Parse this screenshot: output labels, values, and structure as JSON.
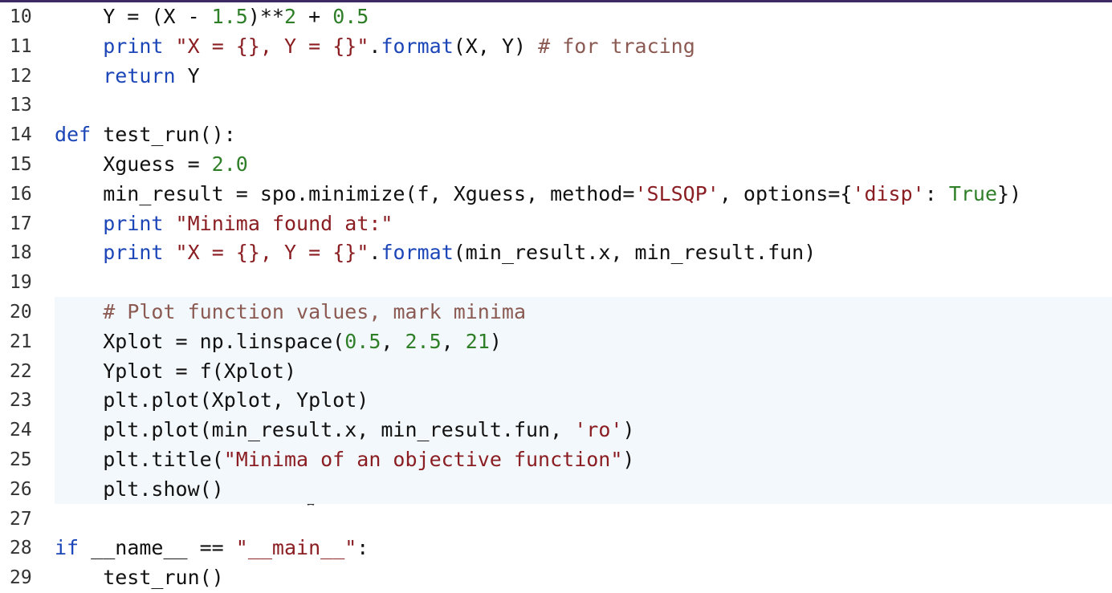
{
  "editor": {
    "lines": [
      {
        "no": "10",
        "tokens": [
          {
            "t": "    Y = (X - ",
            "c": ""
          },
          {
            "t": "1.5",
            "c": "num"
          },
          {
            "t": ")**",
            "c": ""
          },
          {
            "t": "2",
            "c": "num"
          },
          {
            "t": " + ",
            "c": ""
          },
          {
            "t": "0.5",
            "c": "num"
          }
        ]
      },
      {
        "no": "11",
        "tokens": [
          {
            "t": "    ",
            "c": ""
          },
          {
            "t": "print",
            "c": "kw"
          },
          {
            "t": " ",
            "c": ""
          },
          {
            "t": "\"X = {}, Y = {}\"",
            "c": "str"
          },
          {
            "t": ".",
            "c": ""
          },
          {
            "t": "format",
            "c": "kw"
          },
          {
            "t": "(X, Y) ",
            "c": ""
          },
          {
            "t": "# for tracing",
            "c": "com"
          }
        ]
      },
      {
        "no": "12",
        "tokens": [
          {
            "t": "    ",
            "c": ""
          },
          {
            "t": "return",
            "c": "kw"
          },
          {
            "t": " Y",
            "c": ""
          }
        ]
      },
      {
        "no": "13",
        "tokens": []
      },
      {
        "no": "14",
        "tokens": [
          {
            "t": "def",
            "c": "kw"
          },
          {
            "t": " test_run():",
            "c": ""
          }
        ]
      },
      {
        "no": "15",
        "tokens": [
          {
            "t": "    Xguess = ",
            "c": ""
          },
          {
            "t": "2.0",
            "c": "num"
          }
        ]
      },
      {
        "no": "16",
        "tokens": [
          {
            "t": "    min_result = spo.minimize(f, Xguess, method=",
            "c": ""
          },
          {
            "t": "'SLSQP'",
            "c": "str"
          },
          {
            "t": ", options={",
            "c": ""
          },
          {
            "t": "'disp'",
            "c": "str"
          },
          {
            "t": ": ",
            "c": ""
          },
          {
            "t": "True",
            "c": "num"
          },
          {
            "t": "})",
            "c": ""
          }
        ]
      },
      {
        "no": "17",
        "tokens": [
          {
            "t": "    ",
            "c": ""
          },
          {
            "t": "print",
            "c": "kw"
          },
          {
            "t": " ",
            "c": ""
          },
          {
            "t": "\"Minima found at:\"",
            "c": "str"
          }
        ]
      },
      {
        "no": "18",
        "tokens": [
          {
            "t": "    ",
            "c": ""
          },
          {
            "t": "print",
            "c": "kw"
          },
          {
            "t": " ",
            "c": ""
          },
          {
            "t": "\"X = {}, Y = {}\"",
            "c": "str"
          },
          {
            "t": ".",
            "c": ""
          },
          {
            "t": "format",
            "c": "kw"
          },
          {
            "t": "(min_result.x, min_result.fun)",
            "c": ""
          }
        ]
      },
      {
        "no": "19",
        "tokens": []
      },
      {
        "no": "20",
        "hl": true,
        "tokens": [
          {
            "t": "    ",
            "c": ""
          },
          {
            "t": "# Plot function values, mark minima",
            "c": "com"
          }
        ]
      },
      {
        "no": "21",
        "hl": true,
        "tokens": [
          {
            "t": "    Xplot = np.linspace(",
            "c": ""
          },
          {
            "t": "0.5",
            "c": "num"
          },
          {
            "t": ", ",
            "c": ""
          },
          {
            "t": "2.5",
            "c": "num"
          },
          {
            "t": ", ",
            "c": ""
          },
          {
            "t": "21",
            "c": "num"
          },
          {
            "t": ")",
            "c": ""
          }
        ]
      },
      {
        "no": "22",
        "hl": true,
        "tokens": [
          {
            "t": "    Yplot = f(Xplot)",
            "c": ""
          }
        ]
      },
      {
        "no": "23",
        "hl": true,
        "tokens": [
          {
            "t": "    plt.plot(Xplot, Yplot)",
            "c": ""
          }
        ]
      },
      {
        "no": "24",
        "hl": true,
        "tokens": [
          {
            "t": "    plt.plot(min_result.x, min_result.fun, ",
            "c": ""
          },
          {
            "t": "'ro'",
            "c": "str"
          },
          {
            "t": ")",
            "c": ""
          }
        ]
      },
      {
        "no": "25",
        "hl": true,
        "tokens": [
          {
            "t": "    plt.title(",
            "c": ""
          },
          {
            "t": "\"Minima of an objective function\"",
            "c": "str"
          },
          {
            "t": ")",
            "c": ""
          }
        ]
      },
      {
        "no": "26",
        "hl": true,
        "tokens": [
          {
            "t": "    plt.show()",
            "c": ""
          }
        ]
      },
      {
        "no": "27",
        "tokens": []
      },
      {
        "no": "28",
        "tokens": [
          {
            "t": "if",
            "c": "kw"
          },
          {
            "t": " __name__ == ",
            "c": ""
          },
          {
            "t": "\"__main__\"",
            "c": "str"
          },
          {
            "t": ":",
            "c": ""
          }
        ]
      },
      {
        "no": "29",
        "tokens": [
          {
            "t": "    test_run()",
            "c": ""
          }
        ]
      }
    ]
  },
  "colors": {
    "keyword": "#1c46b8",
    "string": "#8a1e22",
    "number": "#2f7f29",
    "comment": "#8b5a52",
    "highlight_bg": "#f3f8fc",
    "top_border": "#3e2a62"
  },
  "cursor_icon": "text-cursor-icon"
}
